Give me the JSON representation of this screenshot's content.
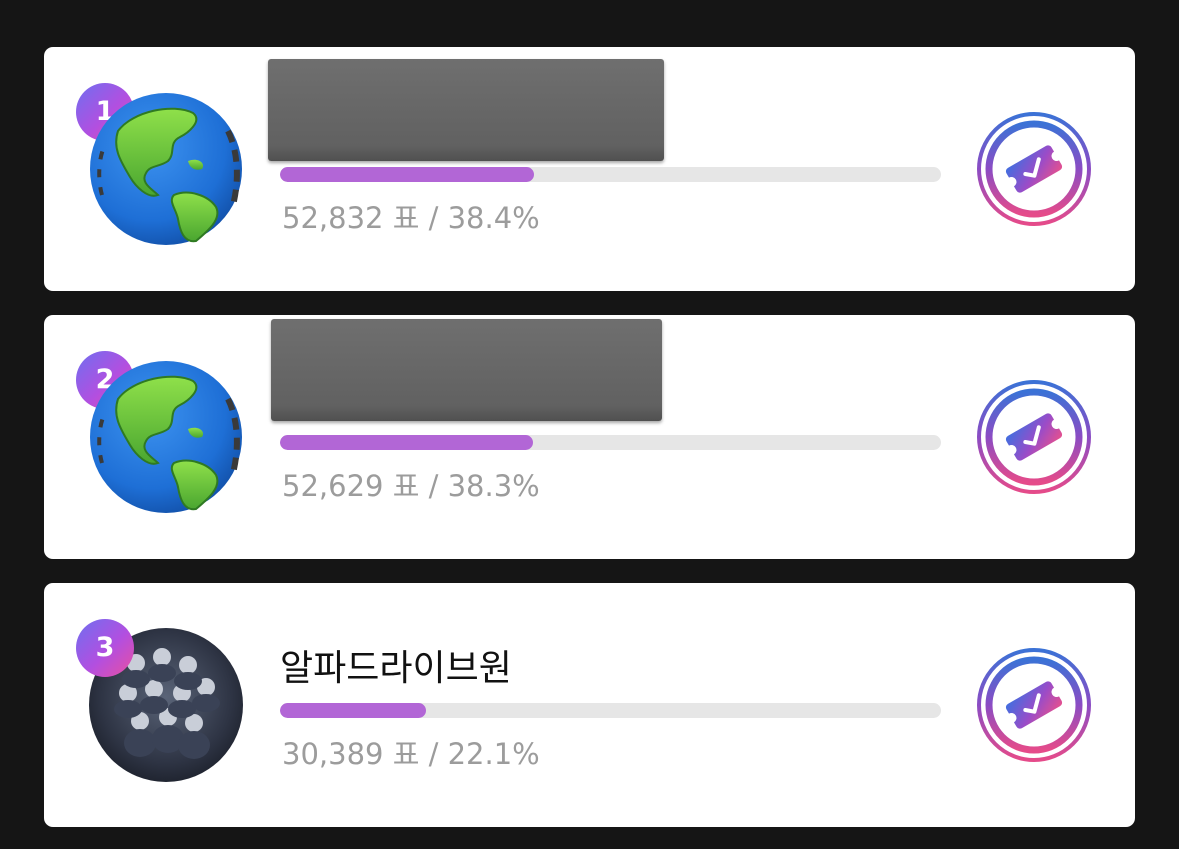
{
  "candidates": [
    {
      "rank": "1",
      "name": "",
      "avatar": "globe-image",
      "votes_text": "52,832 표 / 38.4%",
      "share": 0.384
    },
    {
      "rank": "2",
      "name": "",
      "avatar": "globe-image",
      "votes_text": "52,629 표 / 38.3%",
      "share": 0.383
    },
    {
      "rank": "3",
      "name": "알파드라이브원",
      "avatar": "group-photo",
      "votes_text": "30,389 표 / 22.1%",
      "share": 0.221
    }
  ],
  "vote_button": {
    "icon": "ticket-check-icon"
  },
  "colors": {
    "background": "#151515",
    "card": "#ffffff",
    "bar_fill": "#b266d6",
    "bar_track": "#e6e6e6",
    "stats_text": "#9c9c9c",
    "badge_gradient": [
      "#6f6ff0",
      "#b24fe0",
      "#ea4fa0"
    ],
    "vote_ring_gradient": [
      "#3b72d6",
      "#8b4cc4",
      "#e54b8a"
    ]
  }
}
